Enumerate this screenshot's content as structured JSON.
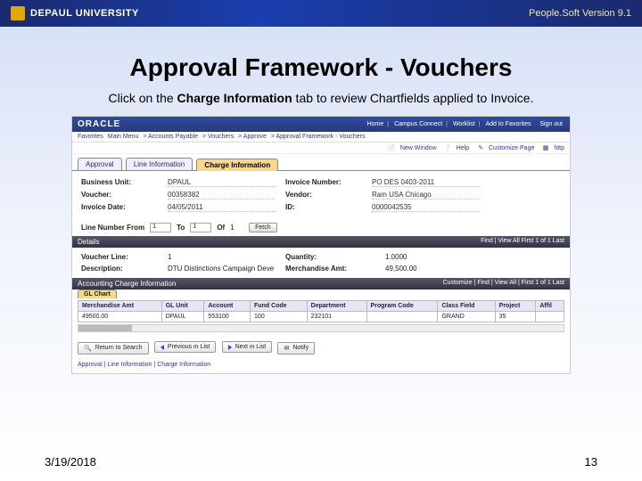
{
  "header": {
    "university": "DEPAUL UNIVERSITY",
    "version": "People.Soft Version 9.1"
  },
  "slide": {
    "title": "Approval Framework - Vouchers",
    "instruction_pre": "Click on the ",
    "instruction_bold": "Charge Information",
    "instruction_post": " tab to review Chartfields applied to Invoice."
  },
  "oracle": {
    "logo": "ORACLE",
    "toplinks": [
      "Home",
      "Campus Connect",
      "Worklist",
      "Add to Favorites",
      "Sign out"
    ],
    "breadcrumb": [
      "Favorites",
      "Main Menu",
      "Accounts Payable",
      "Vouchers",
      "Approve",
      "Approval Framework - Vouchers"
    ],
    "help": {
      "newwin": "New Window",
      "help": "Help",
      "customize": "Customize Page",
      "http": "http"
    },
    "tabs": {
      "approval": "Approval",
      "lineinfo": "Line Information",
      "chargeinfo": "Charge Information"
    },
    "fields": {
      "bu_label": "Business Unit:",
      "bu_val": "DPAUL",
      "inv_label": "Invoice Number:",
      "inv_val": "PO DES 0403-2011",
      "voucher_label": "Voucher:",
      "voucher_val": "00358382",
      "vendor_label": "Vendor:",
      "vendor_val": "Ram USA Chicago",
      "invdate_label": "Invoice Date:",
      "invdate_val": "04/05/2011",
      "id_label": "ID:",
      "id_val": "0000042535"
    },
    "linefrom": {
      "label": "Line Number From",
      "from": "1",
      "to_label": "To",
      "to": "1",
      "of_label": "Of",
      "of": "1",
      "fetch": "Fetch"
    },
    "details": {
      "head": "Details",
      "nav": "Find | View All   First 1 of 1 Last",
      "vline_label": "Voucher Line:",
      "vline_val": "1",
      "qty_label": "Quantity:",
      "qty_val": "1.0000",
      "desc_label": "Description:",
      "desc_val": "DTU Distinctions Campaign Deve",
      "mamt_label": "Merchandise Amt:",
      "mamt_val": "49,500.00"
    },
    "acct": {
      "head": "Accounting Charge Information",
      "nav": "Customize | Find | View All | First 1 of 1 Last",
      "subtab": "GL Chart",
      "cols": [
        "Merchandise Amt",
        "GL Unit",
        "Account",
        "Fund Code",
        "Department",
        "Program Code",
        "Class Field",
        "Project",
        "Affil"
      ],
      "row": [
        "49500.00",
        "DPAUL",
        "553100",
        "100",
        "232101",
        "",
        "GRAND",
        "35",
        ""
      ]
    },
    "buttons": {
      "return": "Return to Search",
      "prev": "Previous in List",
      "next": "Next in List",
      "notify": "Notify"
    },
    "bottomlinks": "Approval | Line Information | Charge Information"
  },
  "footer": {
    "date": "3/19/2018",
    "page": "13"
  }
}
